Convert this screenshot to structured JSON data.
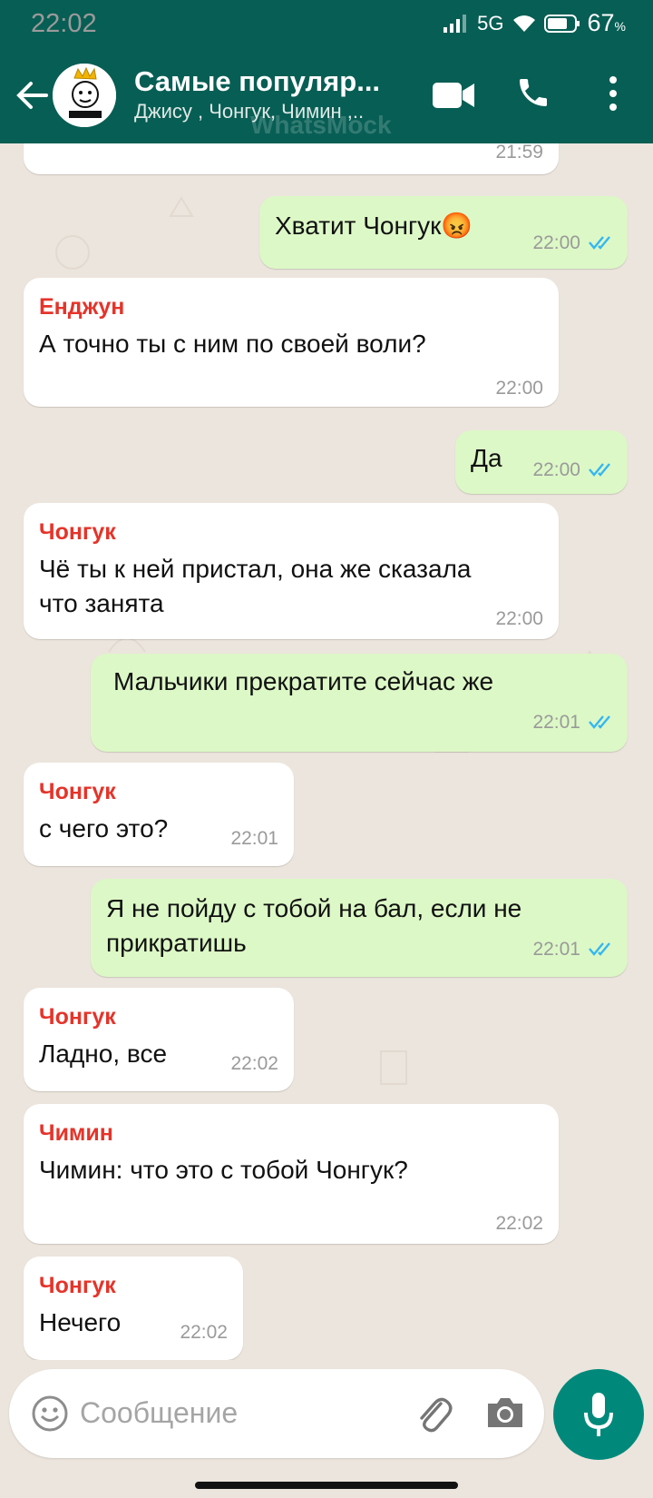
{
  "status": {
    "time": "22:02",
    "network": "5G",
    "battery": "67"
  },
  "header": {
    "title": "Самые популяр...",
    "subtitle": "Джису , Чонгук, Чимин ,..",
    "watermark": "WhatsMock"
  },
  "messages": [
    {
      "dir": "in",
      "text": "",
      "time": "21:59"
    },
    {
      "dir": "out",
      "text": "Хватит Чонгук😡",
      "time": "22:00"
    },
    {
      "dir": "in",
      "sender": "Енджун",
      "text": "А точно ты с ним по своей воли?",
      "time": "22:00"
    },
    {
      "dir": "out",
      "text": "Да",
      "time": "22:00"
    },
    {
      "dir": "in",
      "sender": "Чонгук",
      "text": "Чё ты к ней пристал, она же сказала",
      "text2": "что занята",
      "time": "22:00"
    },
    {
      "dir": "out",
      "text": "Мальчики прекратите сейчас же",
      "time": "22:01"
    },
    {
      "dir": "in",
      "sender": "Чонгук",
      "text": "с чего это?",
      "time": "22:01"
    },
    {
      "dir": "out",
      "text": "Я не пойду с тобой на бал, если не",
      "text2": "прикратишь",
      "time": "22:01"
    },
    {
      "dir": "in",
      "sender": "Чонгук",
      "text": "Ладно, все",
      "time": "22:02"
    },
    {
      "dir": "in",
      "sender": "Чимин",
      "text": "Чимин: что это с тобой Чонгук?",
      "time": "22:02"
    },
    {
      "dir": "in",
      "sender": "Чонгук",
      "text": "Нечего",
      "time": "22:02"
    }
  ],
  "composer": {
    "placeholder": "Сообщение"
  },
  "colors": {
    "header": "#075E54",
    "outgoing": "#DCF8C6",
    "incoming": "#FFFFFF",
    "sender": "#E5342A",
    "ticks": "#34B7F1",
    "fab": "#00897B"
  }
}
